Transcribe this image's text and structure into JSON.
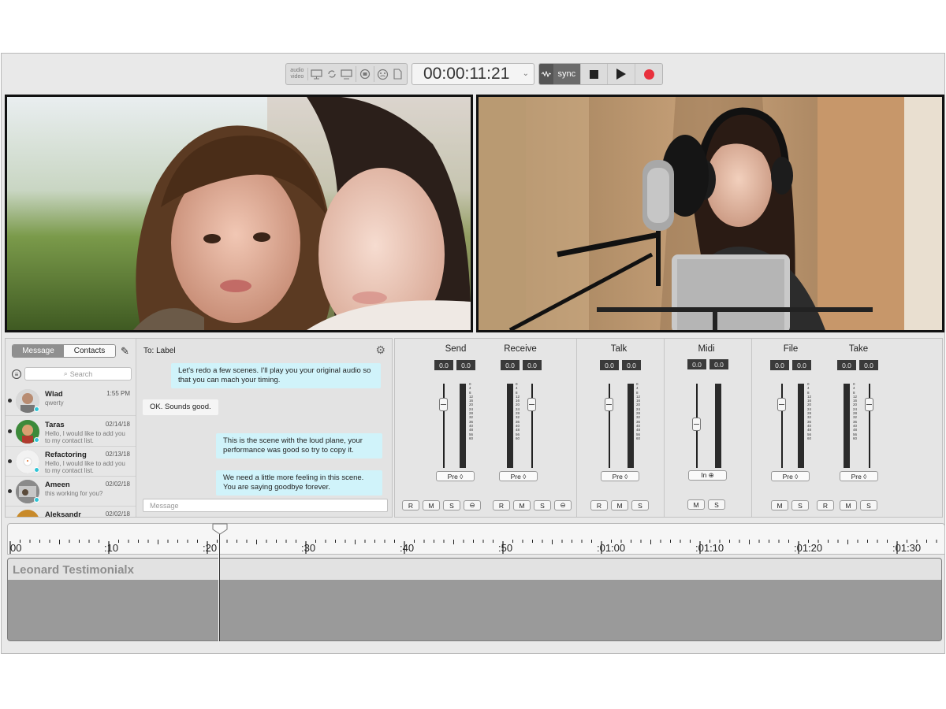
{
  "toolbar": {
    "av_label_top": "audio",
    "av_label_bottom": "video",
    "icons": [
      "display-icon",
      "sync-loop-icon",
      "monitor-icon",
      "printer-icon",
      "pacman-icon",
      "document-icon"
    ],
    "timecode": "00:00:11:21",
    "sync_label": "sync"
  },
  "chat": {
    "tabs": {
      "message": "Message",
      "contacts": "Contacts"
    },
    "search_placeholder": "Search",
    "to_label": "To: Label",
    "message_placeholder": "Message",
    "contacts": [
      {
        "name": "Wlad",
        "time": "1:55 PM",
        "preview": "qwerty"
      },
      {
        "name": "Taras",
        "time": "02/14/18",
        "preview": "Hello, I would like to add you to my contact list."
      },
      {
        "name": "Refactoring",
        "time": "02/13/18",
        "preview": "Hello, I would like to add you to my contact list."
      },
      {
        "name": "Ameen",
        "time": "02/02/18",
        "preview": "this working for you?"
      },
      {
        "name": "Aleksandr",
        "time": "02/02/18",
        "preview": ""
      }
    ],
    "messages": [
      {
        "direction": "out",
        "text": "Let's redo a few scenes. I'll play you your original audio so that you can mach your timing."
      },
      {
        "direction": "in",
        "text": "OK. Sounds good."
      },
      {
        "direction": "out",
        "text": "This is the scene with the loud plane, your performance was good so try to copy it."
      },
      {
        "direction": "out",
        "text": "We need a little more feeling in this scene. You are saying goodbye forever."
      }
    ]
  },
  "mixer": {
    "channels": [
      {
        "title": "Send",
        "values": [
          "0.0",
          "0.0"
        ],
        "button": "Pre ◊"
      },
      {
        "title": "Receive",
        "values": [
          "0.0",
          "0.0"
        ],
        "button": "Pre ◊"
      },
      {
        "title": "Talk",
        "values": [
          "0.0",
          "0.0"
        ],
        "button": "Pre ◊"
      },
      {
        "title": "Midi",
        "values": [
          "0.0",
          "0.0"
        ],
        "button": "In ⊕"
      },
      {
        "title": "File",
        "values": [
          "0.0",
          "0.0"
        ],
        "button": "Pre ◊"
      },
      {
        "title": "Take",
        "values": [
          "0.0",
          "0.0"
        ],
        "button": "Pre ◊"
      }
    ],
    "meter_scale": [
      "0",
      "4",
      "8",
      "12",
      "16",
      "20",
      "24",
      "28",
      "32",
      "36",
      "40",
      "48",
      "56",
      "60"
    ],
    "buttons": {
      "r": "R",
      "m": "M",
      "s": "S",
      "link": "⊖"
    }
  },
  "timeline": {
    "ruler_labels": [
      "00",
      ":10",
      ":20",
      ":30",
      ":40",
      ":50",
      ":01:00",
      ":01:10",
      ":01:20",
      ":01:30"
    ],
    "track_name": "Leonard Testimonialx"
  }
}
